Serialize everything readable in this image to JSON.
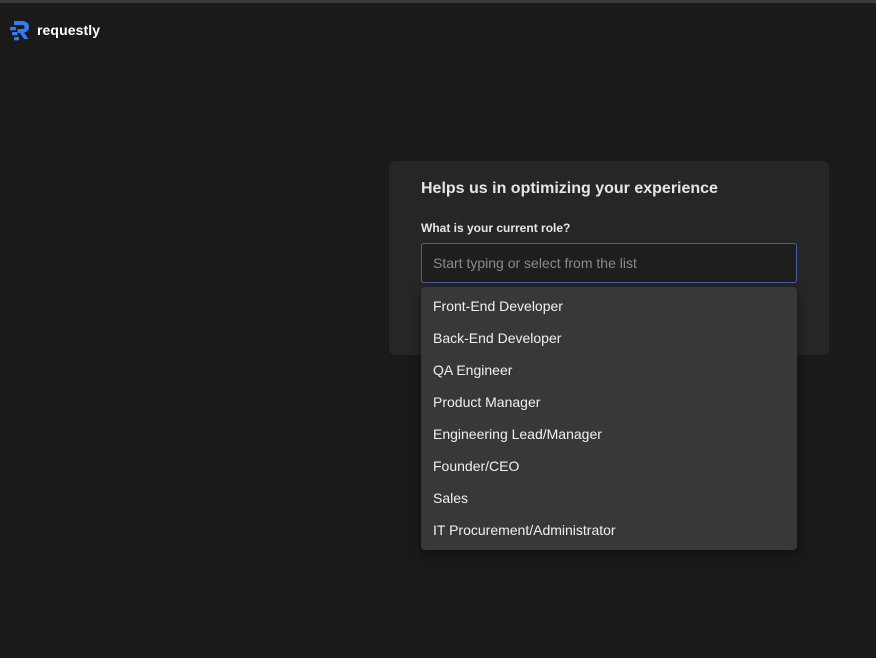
{
  "header": {
    "brand_name": "requestly",
    "logo_icon": "requestly-logo-icon",
    "brand_color": "#2f7cf6"
  },
  "card": {
    "title": "Helps us in optimizing your experience",
    "field_label": "What is your current role?",
    "input": {
      "value": "",
      "placeholder": "Start typing or select from the list"
    }
  },
  "dropdown": {
    "options": [
      "Front-End Developer",
      "Back-End Developer",
      "QA Engineer",
      "Product Manager",
      "Engineering Lead/Manager",
      "Founder/CEO",
      "Sales",
      "IT Procurement/Administrator"
    ]
  },
  "colors": {
    "background": "#1a1a1a",
    "card": "#262626",
    "dropdown": "#383838",
    "input_border": "#4a5fa8"
  }
}
